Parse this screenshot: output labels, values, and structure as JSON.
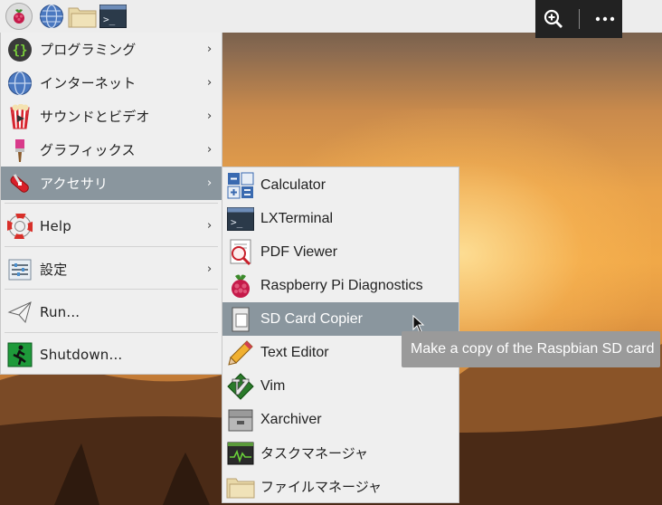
{
  "taskbar": {
    "buttons": [
      {
        "icon": "raspberry-menu-icon"
      },
      {
        "icon": "web-browser-icon"
      },
      {
        "icon": "file-manager-icon"
      },
      {
        "icon": "terminal-icon"
      }
    ],
    "tools": {
      "zoom_icon": "zoom-in-icon",
      "more_icon": "more-options-icon"
    }
  },
  "main_menu": {
    "items": [
      {
        "label": "プログラミング",
        "icon": "programming-icon",
        "has_submenu": true
      },
      {
        "label": "インターネット",
        "icon": "internet-globe-icon",
        "has_submenu": true
      },
      {
        "label": "サウンドとビデオ",
        "icon": "sound-video-icon",
        "has_submenu": true
      },
      {
        "label": "グラフィックス",
        "icon": "graphics-brush-icon",
        "has_submenu": true
      },
      {
        "label": "アクセサリ",
        "icon": "accessories-knife-icon",
        "has_submenu": true,
        "selected": true
      },
      {
        "label": "Help",
        "icon": "help-lifebuoy-icon",
        "has_submenu": true
      },
      {
        "label": "設定",
        "icon": "settings-sliders-icon",
        "has_submenu": true
      },
      {
        "label": "Run...",
        "icon": "run-paper-plane-icon",
        "has_submenu": false
      },
      {
        "label": "Shutdown...",
        "icon": "shutdown-exit-icon",
        "has_submenu": false
      }
    ]
  },
  "accessories_menu": {
    "items": [
      {
        "label": "Calculator",
        "icon": "calculator-icon"
      },
      {
        "label": "LXTerminal",
        "icon": "terminal-icon"
      },
      {
        "label": "PDF Viewer",
        "icon": "pdf-viewer-icon"
      },
      {
        "label": "Raspberry Pi Diagnostics",
        "icon": "raspberry-icon"
      },
      {
        "label": "SD Card Copier",
        "icon": "sd-card-icon",
        "selected": true
      },
      {
        "label": "Text Editor",
        "icon": "pencil-icon"
      },
      {
        "label": "Vim",
        "icon": "vim-icon"
      },
      {
        "label": "Xarchiver",
        "icon": "archive-icon"
      },
      {
        "label": "タスクマネージャ",
        "icon": "task-manager-icon"
      },
      {
        "label": "ファイルマネージャ",
        "icon": "folder-icon"
      }
    ]
  },
  "tooltip": {
    "text": "Make a copy of the Raspbian SD card"
  },
  "colors": {
    "selection": "#8a969e",
    "menu_bg": "#efefef",
    "tooltip_bg": "#9a9a9a"
  }
}
